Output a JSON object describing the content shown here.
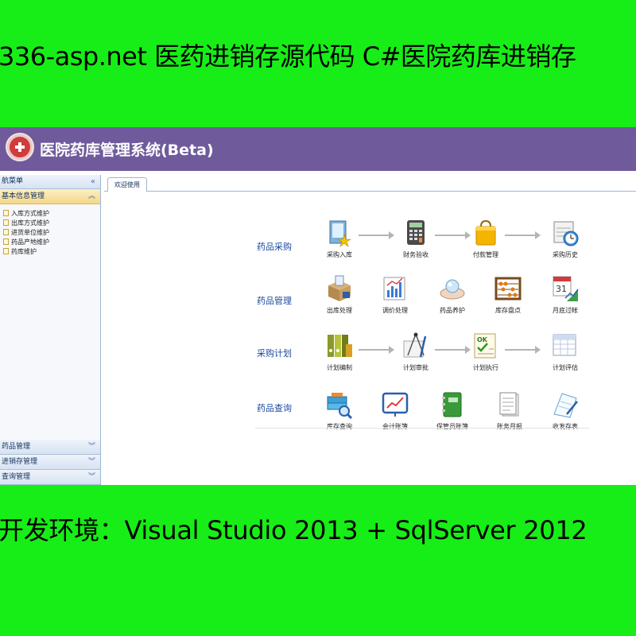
{
  "banner": {
    "top_text": "336-asp.net 医药进销存源代码 C#医院药库进销存",
    "bottom_text": "开发环境：Visual Studio 2013 + SqlServer 2012"
  },
  "app": {
    "title": "医院药库管理系统(Beta)",
    "colors": {
      "titlebar": "#6f5b9c",
      "banner": "#17ee17"
    }
  },
  "sidebar": {
    "header": "航菜单",
    "header_icon": "double-chevron-left-icon",
    "open_group": "基本信息管理",
    "items": [
      "入库方式维护",
      "出库方式维护",
      "进货单位维护",
      "药品产地维护",
      "药库维护"
    ],
    "groups": [
      "药品管理",
      "进销存管理",
      "查询管理"
    ]
  },
  "tab": {
    "label": "欢迎使用"
  },
  "rows": [
    {
      "label": "药品采购",
      "steps": [
        {
          "label": "采购入库",
          "icon": "document-star-icon"
        },
        {
          "label": "财务验收",
          "icon": "calculator-icon"
        },
        {
          "label": "付款管理",
          "icon": "shopping-bag-icon"
        },
        {
          "label": "采购历史",
          "icon": "calendar-clock-icon"
        }
      ]
    },
    {
      "label": "药品管理",
      "steps": [
        {
          "label": "出库处理",
          "icon": "box-out-icon"
        },
        {
          "label": "调价处理",
          "icon": "chart-pencil-icon"
        },
        {
          "label": "药品养护",
          "icon": "hands-care-icon"
        },
        {
          "label": "库存盘点",
          "icon": "abacus-icon"
        },
        {
          "label": "月底过帐",
          "icon": "calendar-chart-icon"
        }
      ]
    },
    {
      "label": "采购计划",
      "steps": [
        {
          "label": "计划编制",
          "icon": "binders-icon"
        },
        {
          "label": "计划审批",
          "icon": "compass-icon"
        },
        {
          "label": "计划执行",
          "icon": "ok-checklist-icon"
        },
        {
          "label": "计划评估",
          "icon": "spreadsheet-icon"
        }
      ]
    },
    {
      "label": "药品查询",
      "steps": [
        {
          "label": "库存查询",
          "icon": "database-search-icon"
        },
        {
          "label": "会计账簿",
          "icon": "trend-board-icon"
        },
        {
          "label": "保管员账簿",
          "icon": "green-book-icon"
        },
        {
          "label": "账务月报",
          "icon": "report-pages-icon"
        },
        {
          "label": "收发存表",
          "icon": "document-pen-icon"
        }
      ]
    }
  ]
}
